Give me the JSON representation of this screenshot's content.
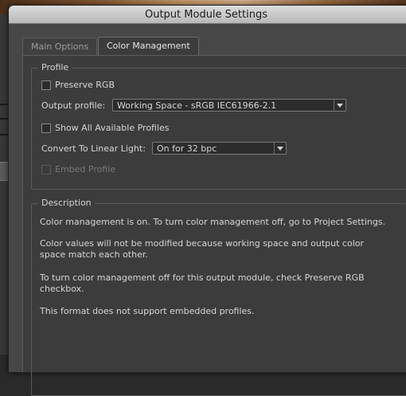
{
  "window": {
    "title": "Output Module Settings"
  },
  "tabs": [
    {
      "label": "Main Options",
      "active": false
    },
    {
      "label": "Color Management",
      "active": true
    }
  ],
  "profile": {
    "group_label": "Profile",
    "preserve_rgb": {
      "label": "Preserve RGB",
      "checked": false
    },
    "output_profile": {
      "label": "Output profile:",
      "value": "Working Space - sRGB IEC61966-2.1"
    },
    "show_all_profiles": {
      "label": "Show All Available Profiles",
      "checked": false
    },
    "convert_linear": {
      "label": "Convert To Linear Light:",
      "value": "On for 32 bpc"
    },
    "embed_profile": {
      "label": "Embed Profile",
      "checked": false,
      "enabled": false
    }
  },
  "description": {
    "group_label": "Description",
    "paragraphs": [
      "Color management is on. To turn color management off, go to Project Settings.",
      "Color values will not be modified because working space and output color space match each other.",
      "To turn color management off for this output module, check Preserve RGB checkbox.",
      "This format does not support embedded profiles."
    ]
  }
}
